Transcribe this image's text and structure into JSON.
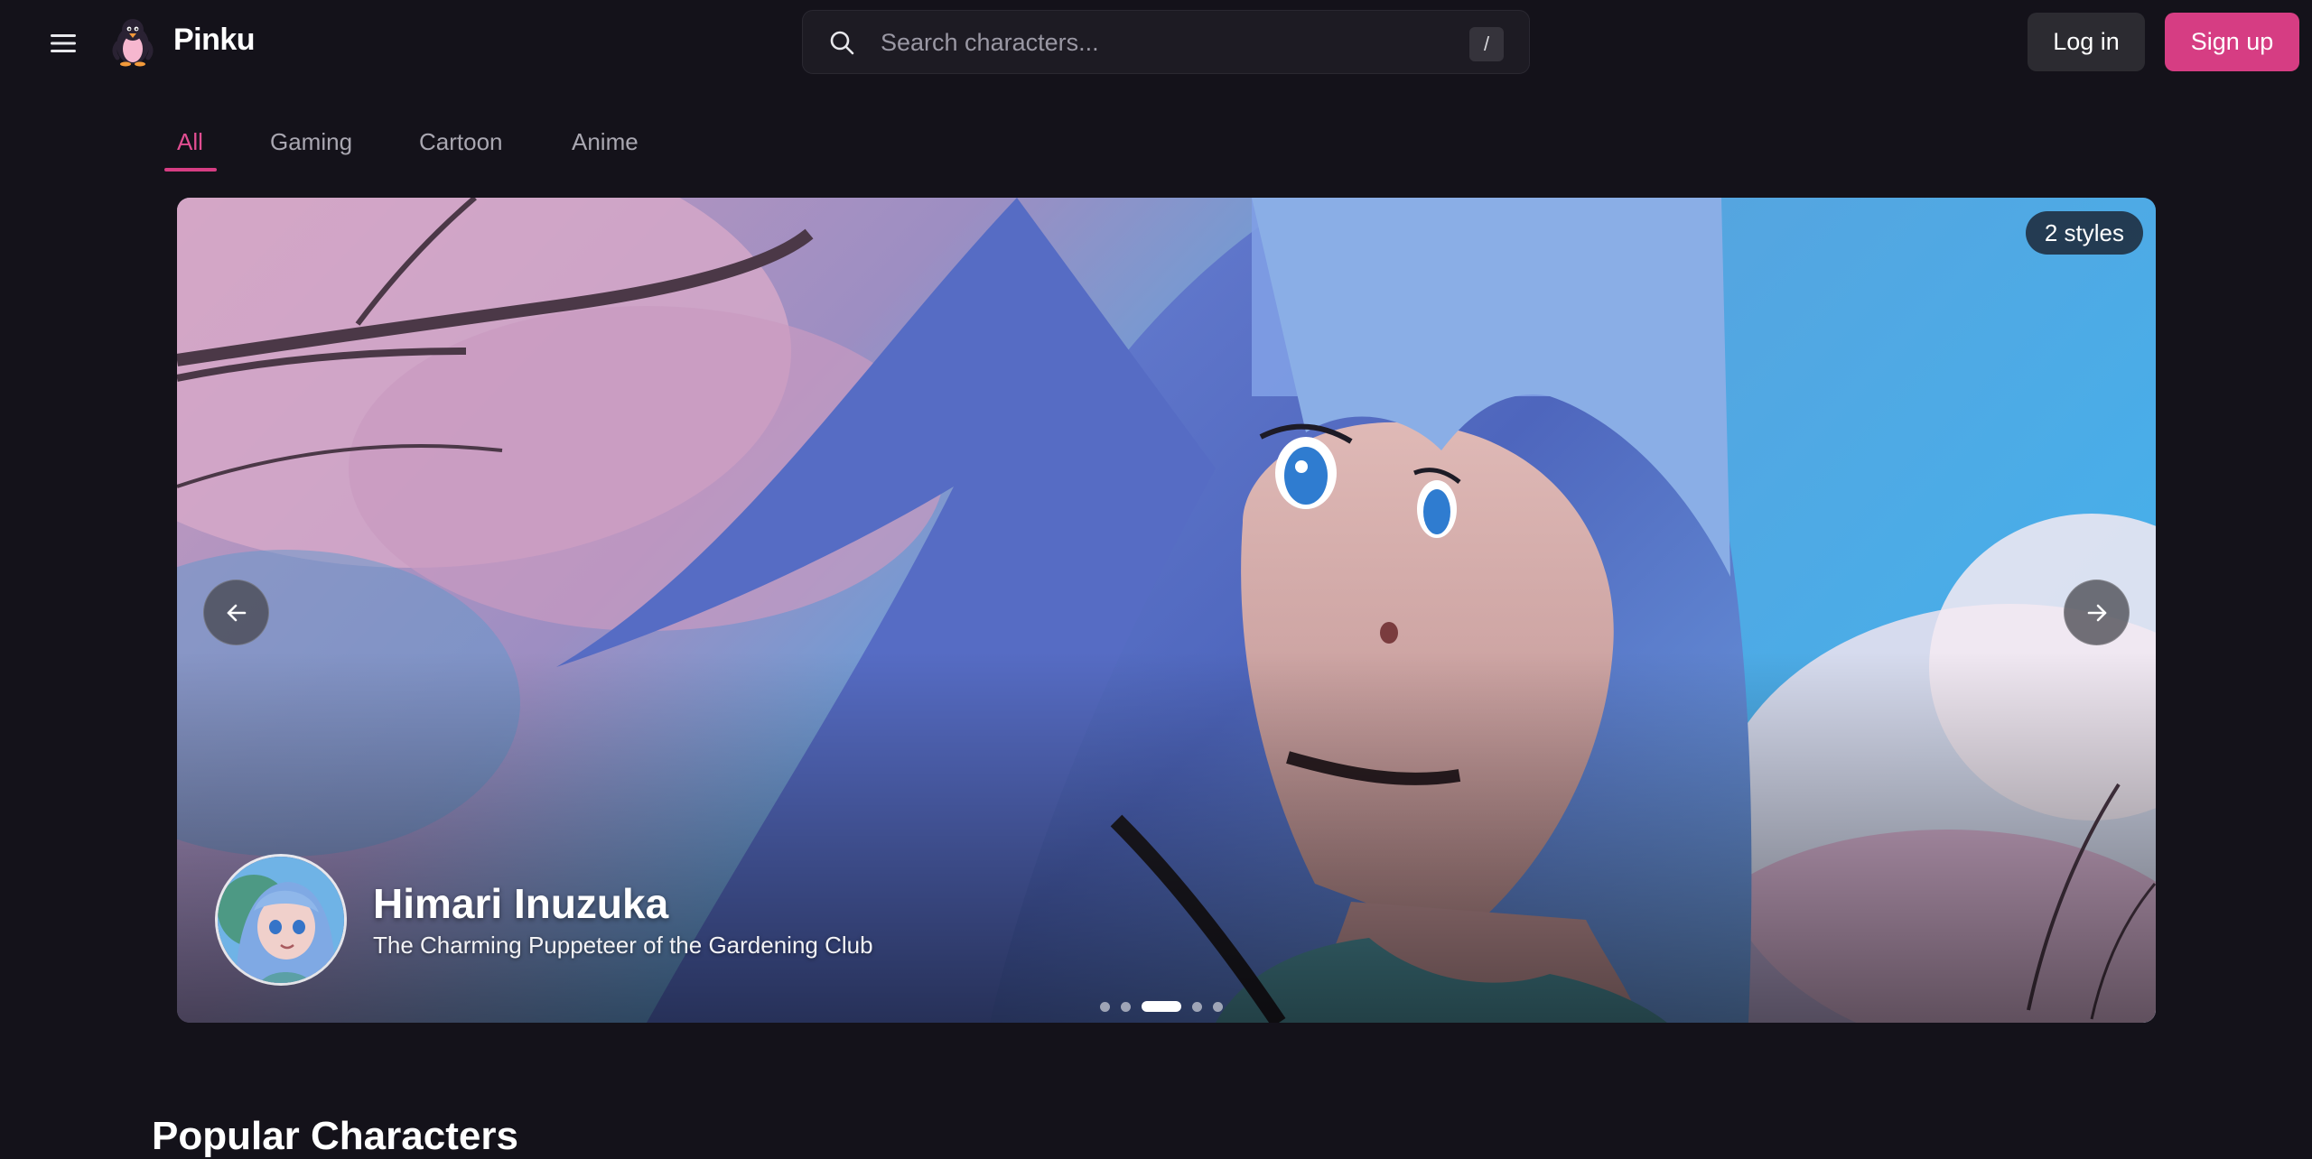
{
  "header": {
    "brand": "Pinku",
    "search_placeholder": "Search characters...",
    "search_shortcut": "/",
    "login_label": "Log in",
    "signup_label": "Sign up",
    "accent_color": "#d63d83"
  },
  "tabs": [
    {
      "label": "All",
      "active": true
    },
    {
      "label": "Gaming",
      "active": false
    },
    {
      "label": "Cartoon",
      "active": false
    },
    {
      "label": "Anime",
      "active": false
    }
  ],
  "hero": {
    "styles_badge": "2 styles",
    "character_name": "Himari Inuzuka",
    "character_tagline": "The Charming Puppeteer of the Gardening Club",
    "slide_count": 5,
    "active_slide": 3
  },
  "sections": {
    "popular_title": "Popular Characters"
  },
  "icons": [
    "menu-icon",
    "penguin-logo-icon",
    "search-icon",
    "arrow-left-icon",
    "arrow-right-icon"
  ]
}
